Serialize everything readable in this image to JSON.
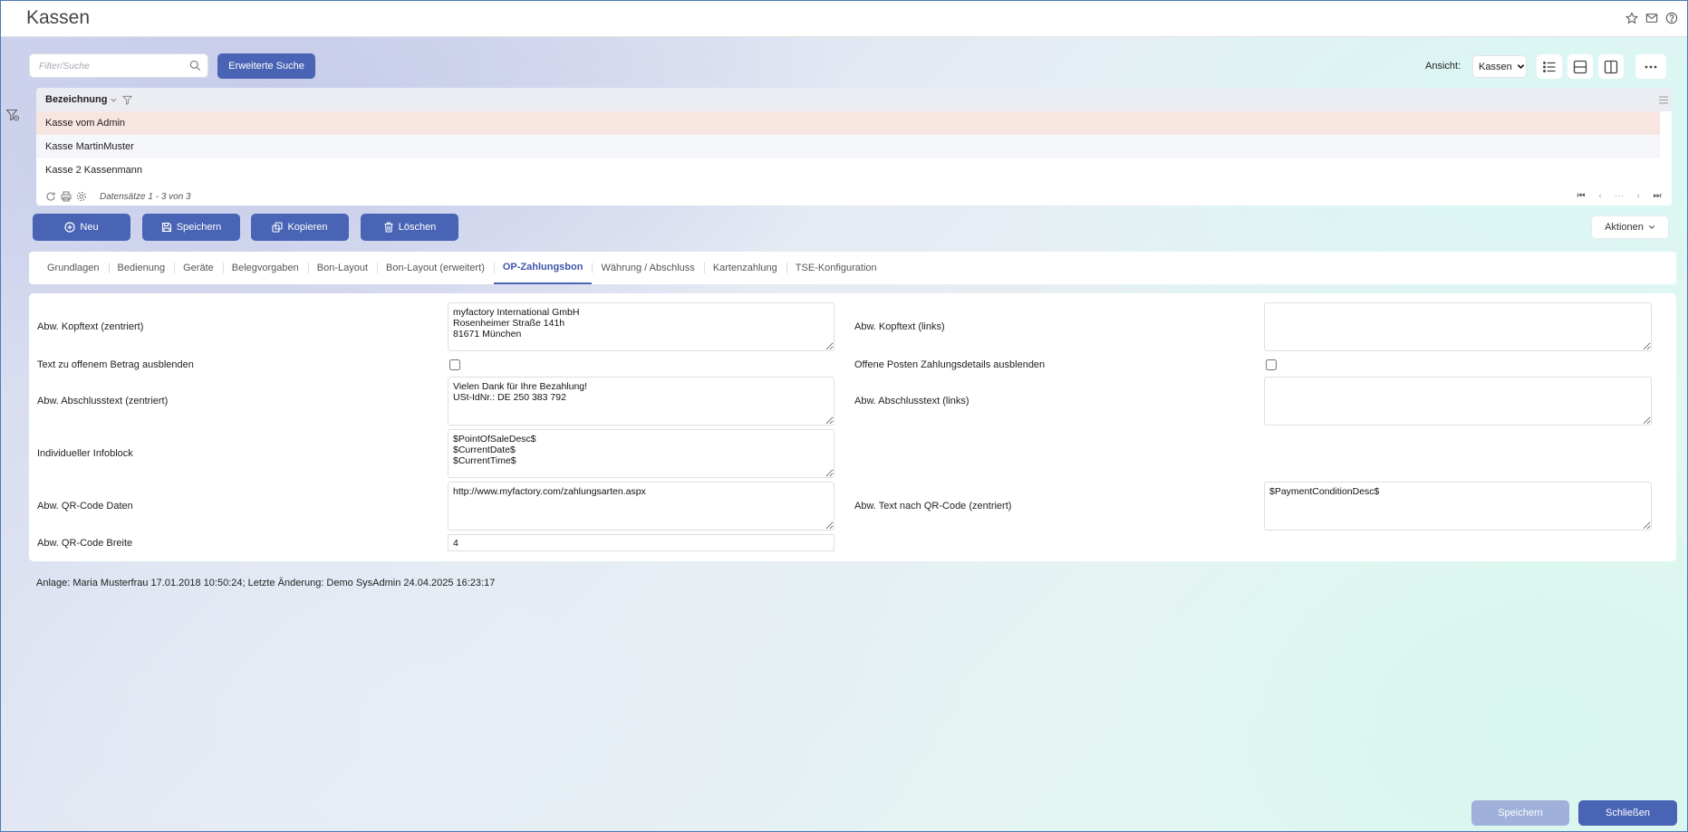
{
  "window": {
    "title": "Kassen"
  },
  "toolbar": {
    "search_placeholder": "Filter/Suche",
    "search_value": "",
    "extended_search_label": "Erweiterte Suche",
    "view_label": "Ansicht:",
    "view_value": "Kassen",
    "view_options": [
      "Kassen"
    ]
  },
  "grid": {
    "column_header": "Bezeichnung",
    "rows": [
      {
        "label": "Kasse vom Admin",
        "selected": true
      },
      {
        "label": "Kasse MartinMuster",
        "selected": false
      },
      {
        "label": "Kasse 2 Kassenmann",
        "selected": false
      }
    ],
    "record_count": "Datensätze 1 - 3 von 3"
  },
  "actions": {
    "new_label": "Neu",
    "save_label": "Speichern",
    "copy_label": "Kopieren",
    "delete_label": "Löschen",
    "actions_label": "Aktionen"
  },
  "tabs": [
    {
      "label": "Grundlagen",
      "active": false
    },
    {
      "label": "Bedienung",
      "active": false
    },
    {
      "label": "Geräte",
      "active": false
    },
    {
      "label": "Belegvorgaben",
      "active": false
    },
    {
      "label": "Bon-Layout",
      "active": false
    },
    {
      "label": "Bon-Layout (erweitert)",
      "active": false
    },
    {
      "label": "OP-Zahlungsbon",
      "active": true
    },
    {
      "label": "Währung / Abschluss",
      "active": false
    },
    {
      "label": "Kartenzahlung",
      "active": false
    },
    {
      "label": "TSE-Konfiguration",
      "active": false
    }
  ],
  "form": {
    "kopftext_zentriert": {
      "label": "Abw. Kopftext (zentriert)",
      "value": "myfactory International GmbH\nRosenheimer Straße 141h\n81671 München"
    },
    "kopftext_links": {
      "label": "Abw. Kopftext (links)",
      "value": ""
    },
    "text_offener_betrag": {
      "label": "Text zu offenem Betrag ausblenden",
      "checked": false
    },
    "op_zahlungsdetails": {
      "label": "Offene Posten Zahlungsdetails ausblenden",
      "checked": false
    },
    "abschlusstext_zentriert": {
      "label": "Abw. Abschlusstext (zentriert)",
      "value": "Vielen Dank für Ihre Bezahlung!\nUSt-IdNr.: DE 250 383 792"
    },
    "abschlusstext_links": {
      "label": "Abw. Abschlusstext (links)",
      "value": ""
    },
    "infoblock": {
      "label": "Individueller Infoblock",
      "value": "$PointOfSaleDesc$\n$CurrentDate$\n$CurrentTime$"
    },
    "qr_daten": {
      "label": "Abw. QR-Code Daten",
      "value": "http://www.myfactory.com/zahlungsarten.aspx"
    },
    "text_nach_qr": {
      "label": "Abw. Text nach QR-Code (zentriert)",
      "value": "$PaymentConditionDesc$"
    },
    "qr_breite": {
      "label": "Abw. QR-Code Breite",
      "value": "4"
    }
  },
  "status": {
    "info": "Anlage: Maria Musterfrau 17.01.2018 10:50:24; Letzte Änderung: Demo SysAdmin 24.04.2025 16:23:17"
  },
  "bottom": {
    "save_label": "Speichern",
    "close_label": "Schließen"
  },
  "colors": {
    "primary": "#4a64b5",
    "primary_disabled": "#9fb0da",
    "selected_row": "#f7e5e2",
    "active_tab": "#3f56a8"
  },
  "icons": [
    "star-icon",
    "mail-icon",
    "help-icon",
    "filter-icon",
    "search-icon",
    "list-view-icon",
    "horizontal-split-icon",
    "vertical-split-icon",
    "more-icon",
    "refresh-icon",
    "print-icon",
    "settings-icon",
    "plus-circle-icon",
    "save-icon",
    "copy-icon",
    "trash-icon"
  ]
}
